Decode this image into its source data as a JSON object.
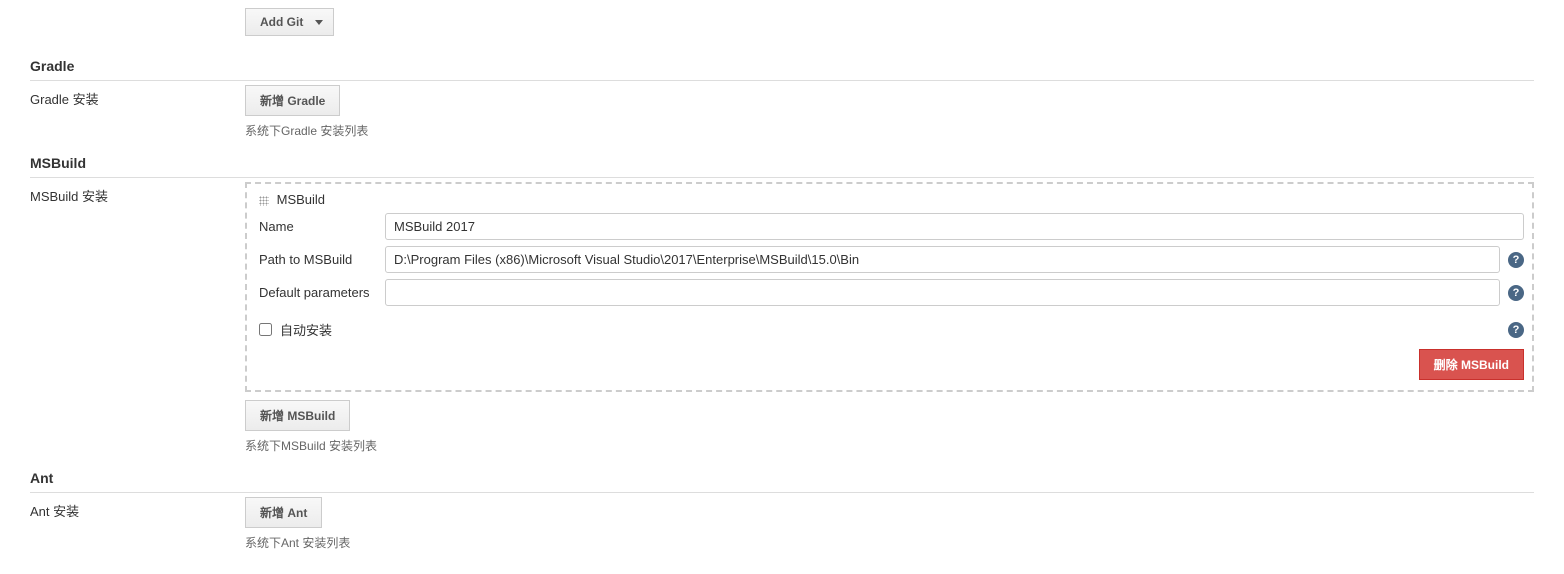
{
  "git": {
    "add_label": "Add Git"
  },
  "gradle": {
    "section_title": "Gradle",
    "install_label": "Gradle 安装",
    "add_label": "新增 Gradle",
    "list_help": "系统下Gradle 安装列表"
  },
  "msbuild": {
    "section_title": "MSBuild",
    "install_label": "MSBuild 安装",
    "item_title": "MSBuild",
    "name_label": "Name",
    "name_value": "MSBuild 2017",
    "path_label": "Path to MSBuild",
    "path_value": "D:\\Program Files (x86)\\Microsoft Visual Studio\\2017\\Enterprise\\MSBuild\\15.0\\Bin",
    "default_params_label": "Default parameters",
    "default_params_value": "",
    "auto_install_label": "自动安装",
    "delete_label": "删除 MSBuild",
    "add_label": "新增 MSBuild",
    "list_help": "系统下MSBuild 安装列表"
  },
  "ant": {
    "section_title": "Ant",
    "install_label": "Ant 安装",
    "add_label": "新增 Ant",
    "list_help": "系统下Ant 安装列表"
  }
}
